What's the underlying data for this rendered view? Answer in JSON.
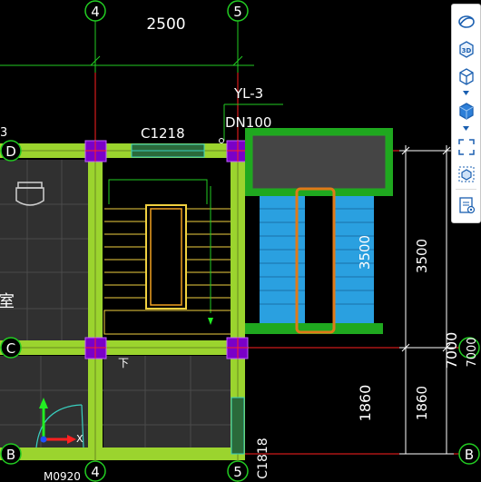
{
  "drawing": {
    "grid_axes": {
      "vertical": [
        "4",
        "5"
      ],
      "horizontal": [
        "D",
        "C",
        "B"
      ]
    },
    "dimensions": {
      "top_span": "2500",
      "stair_height": "3500",
      "right_outer": "3500",
      "right_total": "7000",
      "right_total_overlap": "7000",
      "lower_span": "1860",
      "lower_span_outer": "1860"
    },
    "labels": {
      "pipe_tag": "YL-3",
      "pipe_size": "DN100",
      "window_top": "C1218",
      "window_right": "C1818",
      "door_bottom": "M0920",
      "stair_direction": "下",
      "room_fragment": "室",
      "axis_x": "X",
      "edge_text": "3"
    }
  },
  "toolbar": {
    "buttons": [
      {
        "name": "orbit-icon"
      },
      {
        "name": "3d-view-icon",
        "label": "3D"
      },
      {
        "name": "wireframe-box-icon"
      },
      {
        "name": "solid-box-icon"
      },
      {
        "name": "section-box-icon"
      },
      {
        "name": "isolate-icon"
      },
      {
        "name": "properties-icon"
      }
    ]
  },
  "colors": {
    "background": "#000000",
    "wall": "#9bd42e",
    "column": "#7a00c8",
    "axis": "#ff2020",
    "stair": "#f0d040",
    "water_tank": "#2aa0e0",
    "tank_frame": "#1fa81f",
    "highlight": "#e07a18"
  }
}
